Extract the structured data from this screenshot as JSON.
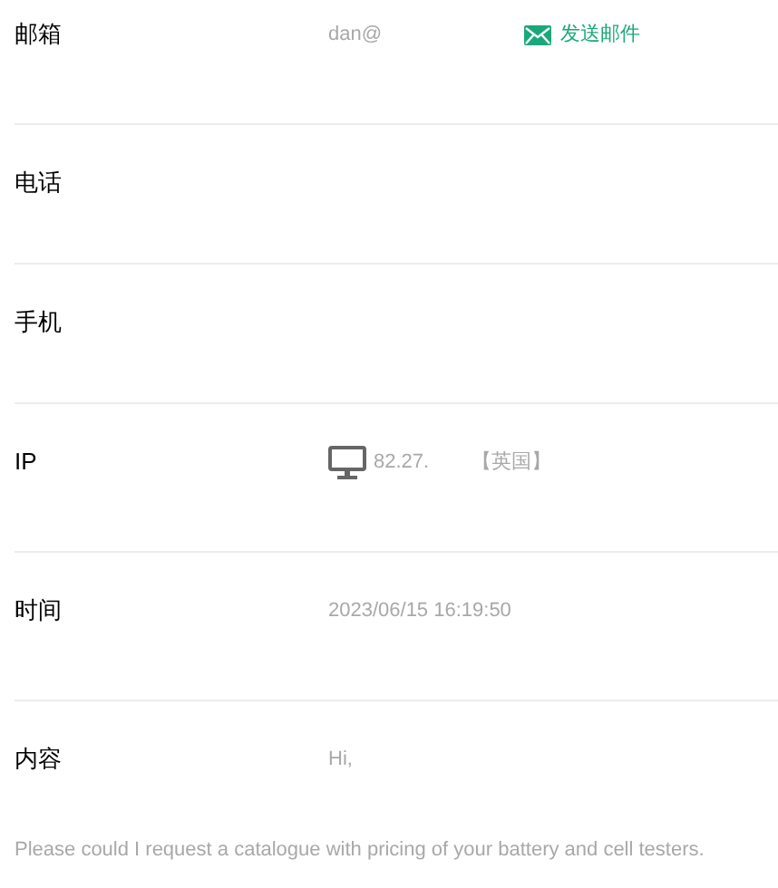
{
  "rows": [
    {
      "kind": "email",
      "label": "邮箱",
      "value": "dan@",
      "action": "发送邮件"
    },
    {
      "kind": "text",
      "label": "电话"
    },
    {
      "kind": "text",
      "label": "手机"
    },
    {
      "kind": "ip",
      "label": "IP",
      "value": "82.27.",
      "region": "【英国】"
    },
    {
      "kind": "text",
      "label": "时间",
      "value": "2023/06/15 16:19:50"
    },
    {
      "kind": "content",
      "label": "内容",
      "value": "Hi,",
      "body": "Please could I request a catalogue with pricing of your battery and cell testers."
    }
  ]
}
